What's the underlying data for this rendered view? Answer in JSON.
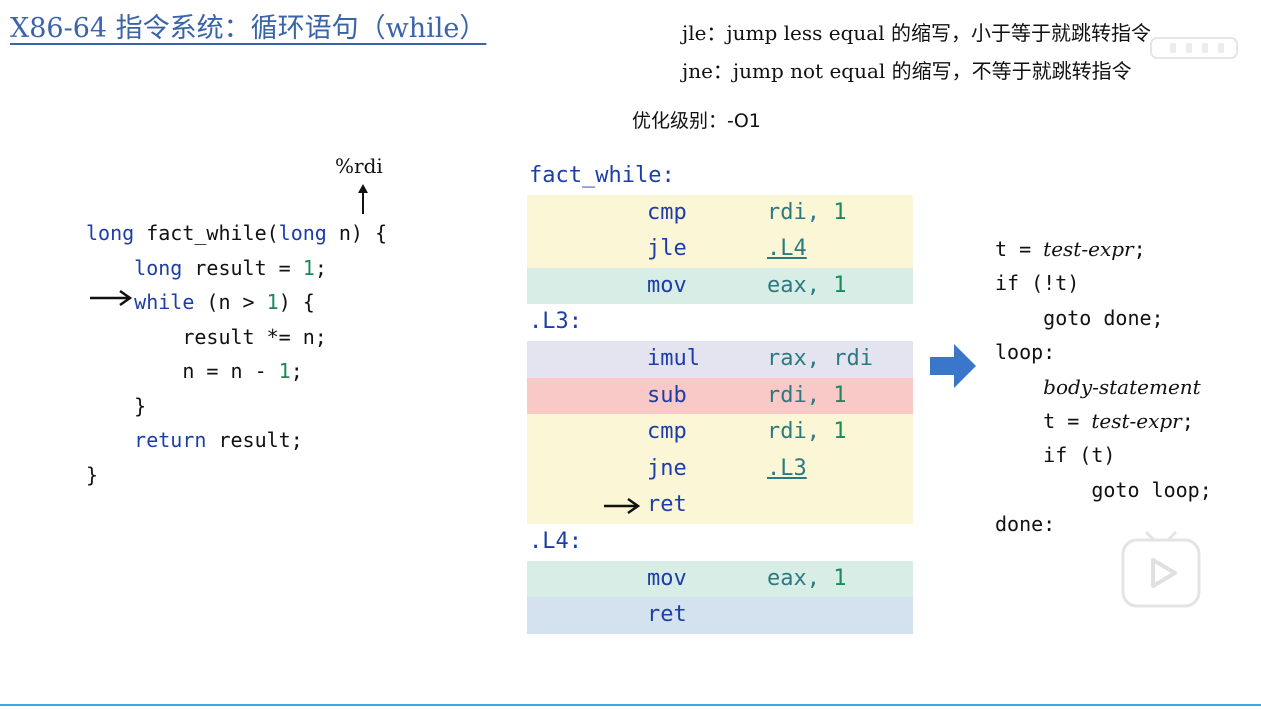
{
  "slide": {
    "title": "X86-64 指令系统：循环语句（while）",
    "note_jle": "jle：jump less equal 的缩写，小于等于就跳转指令",
    "note_jne": "jne：jump not equal 的缩写，不等于就跳转指令",
    "opt_level": "优化级别：-O1"
  },
  "c_source": {
    "rdi_annotation": "%rdi",
    "lines": [
      [
        "long",
        " fact_while(",
        "long",
        " n) {"
      ],
      [
        "    ",
        "long",
        " result = ",
        "1",
        ";"
      ],
      [
        "    ",
        "while",
        " (n > ",
        "1",
        ") {"
      ],
      [
        "        result *= n;"
      ],
      [
        "        n = n - ",
        "1",
        ";"
      ],
      [
        "    }"
      ],
      [
        "    ",
        "return",
        " result;"
      ],
      [
        "}"
      ]
    ]
  },
  "assembly": {
    "label_fact_while": "fact_while:",
    "label_l3": ".L3:",
    "label_l4": ".L4:",
    "rows": [
      {
        "op": "cmp",
        "arg": "rdi, ",
        "num": "1"
      },
      {
        "op": "jle",
        "link": ".L4"
      },
      {
        "op": "mov",
        "arg": "eax, ",
        "num": "1"
      },
      {
        "op": "imul",
        "arg": "rax, rdi"
      },
      {
        "op": "sub",
        "arg": "rdi, ",
        "num": "1"
      },
      {
        "op": "cmp",
        "arg": "rdi, ",
        "num": "1"
      },
      {
        "op": "jne",
        "link": ".L3"
      },
      {
        "op": "ret"
      },
      {
        "op": "mov",
        "arg": "eax, ",
        "num": "1"
      },
      {
        "op": "ret"
      }
    ]
  },
  "pseudo": {
    "l1a": "t = ",
    "l1b": "test-expr",
    "l1c": ";",
    "l2": "if (!t)",
    "l3": "    goto done;",
    "l4": "loop:",
    "l5": "body-statement",
    "l6a": "    t = ",
    "l6b": "test-expr",
    "l6c": ";",
    "l7": "    if (t)",
    "l8": "        goto loop;",
    "l9": "done:"
  },
  "icons": [
    "up-arrow",
    "right-arrow",
    "block-arrow-right",
    "watermark-logo",
    "play-icon"
  ],
  "colors": {
    "title": "#3b63a8",
    "keyword": "#1d3ea8",
    "number": "#1a8a5a",
    "register": "#2b7a82",
    "row_yellow": "#fbf6d6",
    "row_green": "#d8ede5",
    "row_purple": "#e4e3f0",
    "row_red": "#f8c9c6",
    "row_blue": "#d3e2ee",
    "arrow_blue": "#3a76c9",
    "bottom_line": "#3aa7e6"
  }
}
